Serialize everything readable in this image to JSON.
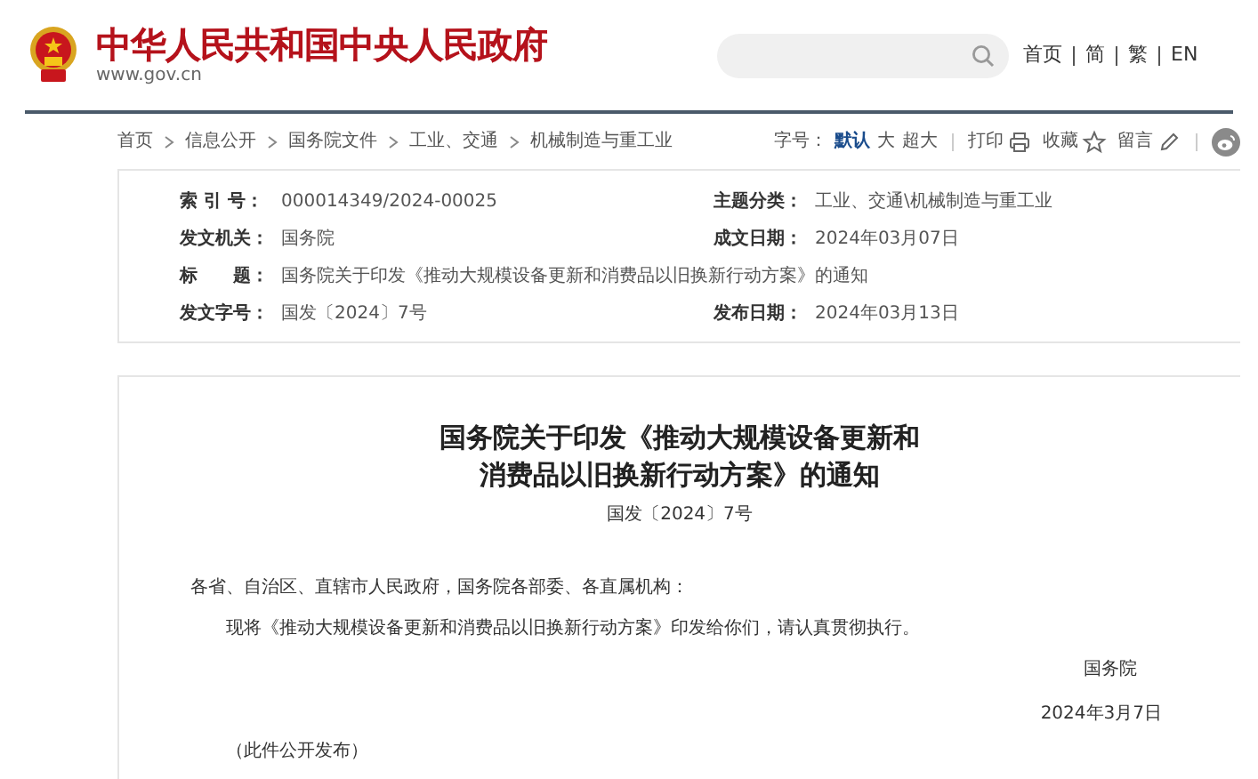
{
  "header": {
    "site_title": "中华人民共和国中央人民政府",
    "site_url": "www.gov.cn",
    "nav_links": [
      "首页",
      "简",
      "繁",
      "EN"
    ]
  },
  "breadcrumb": [
    "首页",
    "信息公开",
    "国务院文件",
    "工业、交通",
    "机械制造与重工业"
  ],
  "font_size": {
    "label": "字号：",
    "options": [
      {
        "label": "默认",
        "selected": true
      },
      {
        "label": "大",
        "selected": false
      },
      {
        "label": "超大",
        "selected": false
      }
    ]
  },
  "tools": [
    {
      "label": "打印",
      "kind": "print"
    },
    {
      "label": "收藏",
      "kind": "star"
    },
    {
      "label": "留言",
      "kind": "pencil"
    }
  ],
  "metadata": [
    [
      {
        "label": "索 引 号：",
        "value": "000014349/2024-00025"
      },
      {
        "label": "主题分类：",
        "value": "工业、交通\\机械制造与重工业"
      }
    ],
    [
      {
        "label": "发文机关：",
        "value": "国务院"
      },
      {
        "label": "成文日期：",
        "value": "2024年03月07日"
      }
    ],
    [
      {
        "label": "标　　题：",
        "value": "国务院关于印发《推动大规模设备更新和消费品以旧换新行动方案》的通知"
      }
    ],
    [
      {
        "label": "发文字号：",
        "value": "国发〔2024〕7号"
      },
      {
        "label": "发布日期：",
        "value": "2024年03月13日"
      }
    ]
  ],
  "document": {
    "title_lines": [
      "国务院关于印发《推动大规模设备更新和",
      "消费品以旧换新行动方案》的通知"
    ],
    "doc_number": "国发〔2024〕7号",
    "salutation": "各省、自治区、直辖市人民政府，国务院各部委、各直属机构：",
    "body": "现将《推动大规模设备更新和消费品以旧换新行动方案》印发给你们，请认真贯彻执行。",
    "signature": "国务院",
    "date": "2024年3月7日",
    "note": "（此件公开发布）"
  }
}
